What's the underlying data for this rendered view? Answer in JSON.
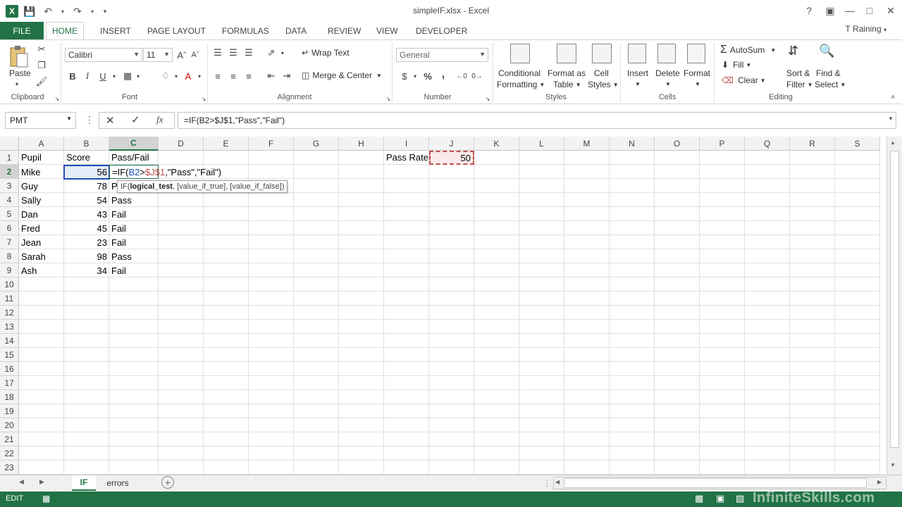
{
  "window": {
    "title": "simpleIF.xlsx - Excel",
    "help": "?",
    "user": "T Raining"
  },
  "tabs": {
    "file": "FILE",
    "items": [
      "HOME",
      "INSERT",
      "PAGE LAYOUT",
      "FORMULAS",
      "DATA",
      "REVIEW",
      "VIEW",
      "DEVELOPER"
    ]
  },
  "ribbon": {
    "clipboard": {
      "paste": "Paste",
      "label": "Clipboard"
    },
    "font": {
      "name": "Calibri",
      "size": "11",
      "bold": "B",
      "italic": "I",
      "underline": "U",
      "label": "Font"
    },
    "alignment": {
      "wrap": "Wrap Text",
      "merge": "Merge & Center",
      "label": "Alignment"
    },
    "number": {
      "format": "General",
      "currency": "$",
      "percent": "%",
      "comma": ",",
      "label": "Number"
    },
    "styles": {
      "conditional1": "Conditional",
      "conditional2": "Formatting",
      "table1": "Format as",
      "table2": "Table",
      "cell1": "Cell",
      "cell2": "Styles",
      "label": "Styles"
    },
    "cells": {
      "insert": "Insert",
      "delete": "Delete",
      "format": "Format",
      "label": "Cells"
    },
    "editing": {
      "autosum": "AutoSum",
      "fill": "Fill",
      "clear": "Clear",
      "sort1": "Sort &",
      "sort2": "Filter",
      "find1": "Find &",
      "find2": "Select",
      "label": "Editing"
    }
  },
  "formula_bar": {
    "name_box": "PMT",
    "formula": "=IF(B2>$J$1,\"Pass\",\"Fail\")"
  },
  "grid": {
    "columns": [
      "A",
      "B",
      "C",
      "D",
      "E",
      "F",
      "G",
      "H",
      "I",
      "J",
      "K",
      "L",
      "M",
      "N",
      "O",
      "P",
      "Q",
      "R",
      "S"
    ],
    "rows": [
      "1",
      "2",
      "3",
      "4",
      "5",
      "6",
      "7",
      "8",
      "9",
      "10",
      "11",
      "12",
      "13",
      "14",
      "15",
      "16",
      "17",
      "18",
      "19",
      "20",
      "21",
      "22",
      "23"
    ],
    "header_row": {
      "a": "Pupil",
      "b": "Score",
      "c": "Pass/Fail"
    },
    "pass_rate_label": "Pass Rate",
    "pass_rate_value": "50",
    "edit_prefix": "=IF(",
    "edit_ref1": "B2",
    "edit_gt": ">",
    "edit_ref2": "$J$1",
    "edit_rest": ",\"Pass\",\"Fail\")",
    "c3_partial": "P",
    "records": [
      {
        "pupil": "Mike",
        "score": "56",
        "result": ""
      },
      {
        "pupil": "Guy",
        "score": "78",
        "result": ""
      },
      {
        "pupil": "Sally",
        "score": "54",
        "result": "Pass"
      },
      {
        "pupil": "Dan",
        "score": "43",
        "result": "Fail"
      },
      {
        "pupil": "Fred",
        "score": "45",
        "result": "Fail"
      },
      {
        "pupil": "Jean",
        "score": "23",
        "result": "Fail"
      },
      {
        "pupil": "Sarah",
        "score": "98",
        "result": "Pass"
      },
      {
        "pupil": "Ash",
        "score": "34",
        "result": "Fail"
      }
    ],
    "tooltip": {
      "fn": "IF(",
      "arg1": "logical_test",
      "rest": ", [value_if_true], [value_if_false])"
    }
  },
  "sheets": [
    "IF",
    "errors"
  ],
  "status": {
    "mode": "EDIT",
    "watermark": "InfiniteSkills.com"
  },
  "colors": {
    "excel_green": "#217346",
    "ref_blue": "#1f4eb5",
    "ref_red": "#c0504d"
  }
}
